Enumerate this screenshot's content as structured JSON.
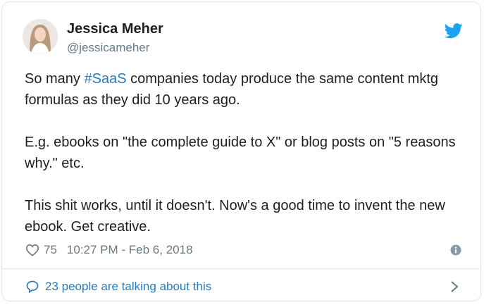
{
  "tweet": {
    "author_name": "Jessica Meher",
    "author_handle": "@jessicameher",
    "text_part1": "So many ",
    "hashtag": "#SaaS",
    "text_part2": " companies today produce the same content mktg formulas as they did 10 years ago.\n\nE.g. ebooks on \"the complete guide to X\" or blog posts on \"5 reasons why.\" etc.\n\nThis shit works, until it doesn't. Now's a good time to invent the new ebook. Get creative.",
    "like_count": "75",
    "timestamp": "10:27 PM - Feb 6, 2018"
  },
  "conversation": {
    "label": "23 people are talking about this"
  },
  "colors": {
    "link": "#2b7bb9",
    "twitter_blue": "#1da1f2",
    "muted": "#697882",
    "border": "#e1e8ed"
  },
  "icons": [
    "twitter-bird-icon",
    "heart-icon",
    "info-icon",
    "speech-bubble-icon",
    "chevron-right-icon"
  ]
}
